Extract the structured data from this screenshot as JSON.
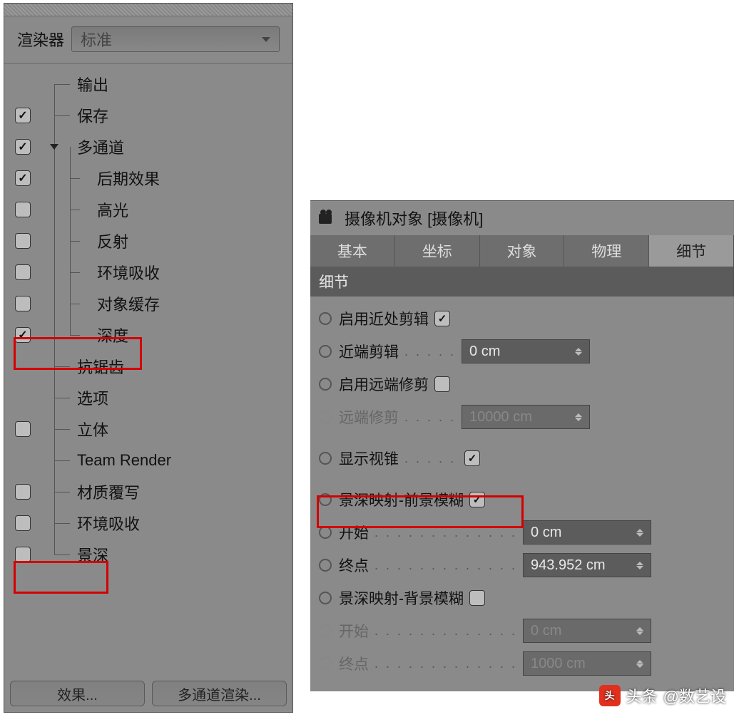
{
  "left": {
    "renderer_label": "渲染器",
    "renderer_value": "标准",
    "items": {
      "output": "输出",
      "save": "保存",
      "multipass": "多通道",
      "posteffects": "后期效果",
      "specular": "高光",
      "reflection": "反射",
      "ao_mp": "环境吸收",
      "objbuffer": "对象缓存",
      "depth": "深度",
      "aa": "抗锯齿",
      "options": "选项",
      "stereo": "立体",
      "teamrender": "Team Render",
      "matoverride": "材质覆写",
      "ao": "环境吸收",
      "dof": "景深"
    },
    "buttons": {
      "effects": "效果...",
      "multipass_btn": "多通道渲染..."
    }
  },
  "right": {
    "title": "摄像机对象 [摄像机]",
    "tabs": {
      "basic": "基本",
      "coord": "坐标",
      "object": "对象",
      "physical": "物理",
      "details": "细节"
    },
    "section": "细节",
    "props": {
      "near_clip_enable": "启用近处剪辑",
      "near_clip": "近端剪辑",
      "near_clip_val": "0 cm",
      "far_clip_enable": "启用远端修剪",
      "far_clip": "远端修剪",
      "far_clip_val": "10000 cm",
      "show_cone": "显示视锥",
      "dof_front": "景深映射-前景模糊",
      "start1": "开始",
      "start1_val": "0 cm",
      "end1": "终点",
      "end1_val": "943.952 cm",
      "dof_back": "景深映射-背景模糊",
      "start2": "开始",
      "start2_val": "0 cm",
      "end2": "终点",
      "end2_val": "1000 cm"
    }
  },
  "watermark": {
    "prefix": "头条",
    "handle": "@数艺设"
  }
}
